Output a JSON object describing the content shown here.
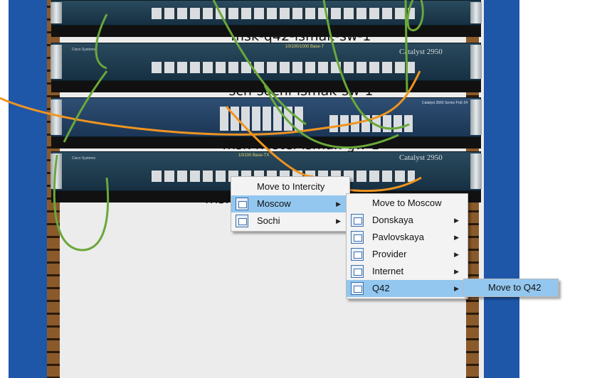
{
  "devices": [
    {
      "name": "msk-q42-ismak-sw-1"
    },
    {
      "name": "sch-sochi-ismak-sw-1"
    },
    {
      "name": "msk-hostel-ismak-gw-1"
    },
    {
      "name": "msk"
    }
  ],
  "switch_labels": {
    "brand": "Cisco Systems",
    "speed": "10/100/1000 Base-T",
    "speed_tx": "10/100 Base-TX",
    "model": "Catalyst 2950",
    "gw_model": "Catalyst 3560 Series PoE-24"
  },
  "context_menu": {
    "items": [
      {
        "label": "Move to Intercity",
        "icon": "",
        "submenu": false
      },
      {
        "label": "Moscow",
        "icon": "building-icon",
        "submenu": true
      },
      {
        "label": "Sochi",
        "icon": "building-icon",
        "submenu": true
      }
    ]
  },
  "moscow_submenu": {
    "items": [
      {
        "label": "Move to Moscow",
        "icon": "",
        "submenu": false
      },
      {
        "label": "Donskaya",
        "icon": "building-icon",
        "submenu": true
      },
      {
        "label": "Pavlovskaya",
        "icon": "building-icon",
        "submenu": true
      },
      {
        "label": "Provider",
        "icon": "building-icon",
        "submenu": true
      },
      {
        "label": "Internet",
        "icon": "building-icon",
        "submenu": true
      },
      {
        "label": "Q42",
        "icon": "building-icon",
        "submenu": true
      }
    ]
  },
  "q42_submenu": {
    "items": [
      {
        "label": "Move to Q42"
      }
    ]
  },
  "colors": {
    "highlight": "#93c7ef",
    "cable_green": "#6aa83a",
    "cable_orange": "#f0941f",
    "side_panel": "#1e56a8"
  }
}
